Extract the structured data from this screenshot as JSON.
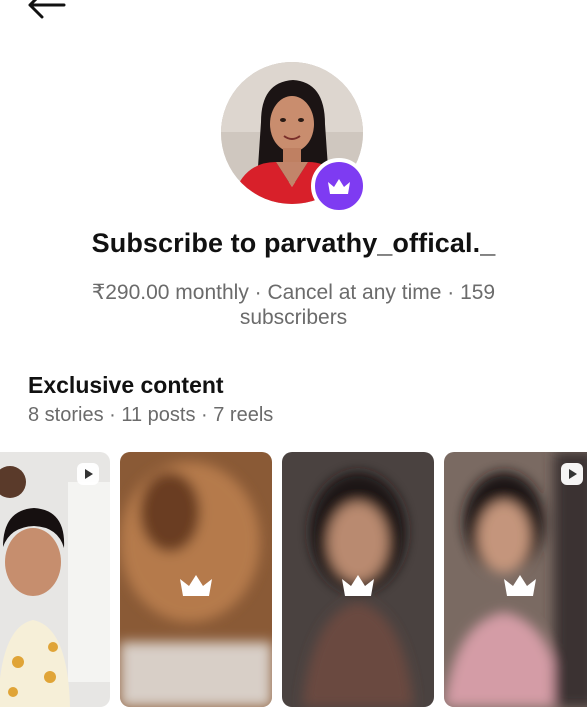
{
  "header": {
    "back_icon": "arrow-left-icon"
  },
  "profile": {
    "avatar_alt": "profile photo",
    "badge_icon": "crown-icon",
    "badge_color": "#7e3bf2"
  },
  "subscribe": {
    "title": "Subscribe to parvathy_offical._",
    "price_line": "₹290.00 monthly · Cancel at any time · 159 subscribers"
  },
  "exclusive": {
    "title": "Exclusive content",
    "counts": "8 stories · 11 posts · 7 reels"
  },
  "thumbnails": [
    {
      "type": "reel",
      "locked": false,
      "icon": "reel-icon"
    },
    {
      "type": "post",
      "locked": true,
      "icon": "crown-icon"
    },
    {
      "type": "post",
      "locked": true,
      "icon": "crown-icon"
    },
    {
      "type": "reel",
      "locked": true,
      "icon": "crown-icon"
    }
  ]
}
